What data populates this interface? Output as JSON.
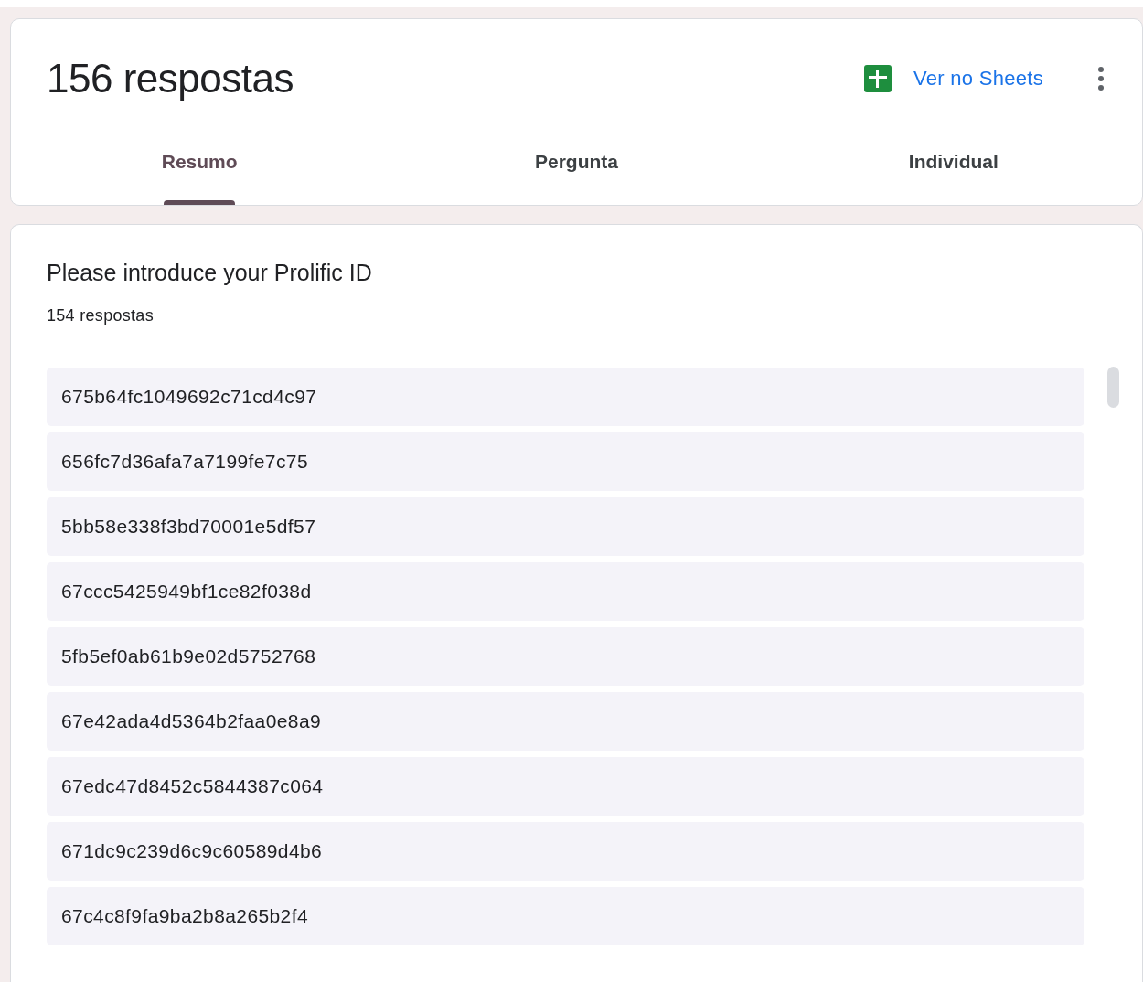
{
  "header": {
    "title": "156 respostas",
    "sheets_link": "Ver no Sheets"
  },
  "tabs": [
    {
      "label": "Resumo",
      "selected": true
    },
    {
      "label": "Pergunta",
      "selected": false
    },
    {
      "label": "Individual",
      "selected": false
    }
  ],
  "question": {
    "title": "Please introduce your Prolific ID",
    "count": "154 respostas",
    "answers": [
      "675b64fc1049692c71cd4c97",
      "656fc7d36afa7a7199fe7c75",
      "5bb58e338f3bd70001e5df57",
      "67ccc5425949bf1ce82f038d",
      "5fb5ef0ab61b9e02d5752768",
      "67e42ada4d5364b2faa0e8a9",
      "67edc47d8452c5844387c064",
      "671dc9c239d6c9c60589d4b6",
      "67c4c8f9fa9ba2b8a265b2f4"
    ]
  }
}
